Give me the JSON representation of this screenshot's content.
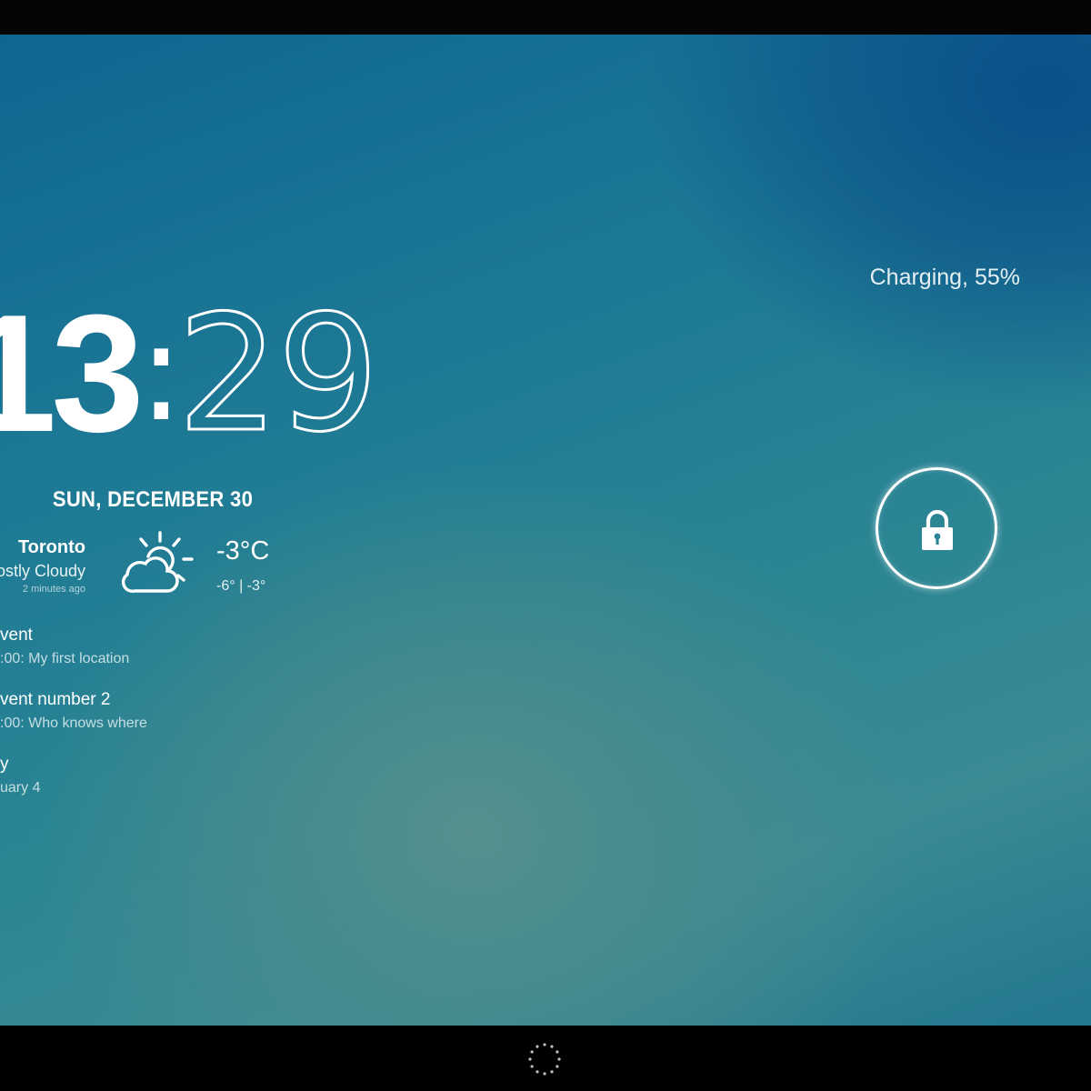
{
  "clock": {
    "hours": "13",
    "separator": ":",
    "minutes": "29"
  },
  "date": "SUN, DECEMBER 30",
  "weather": {
    "city": "Toronto",
    "condition": "ostly Cloudy",
    "updated": "2 minutes ago",
    "icon": "partly-cloudy-icon",
    "temperature": "-3°C",
    "range": "-6° | -3°"
  },
  "events": [
    {
      "title": "vent",
      "detail": ":00: My first location"
    },
    {
      "title": "vent number 2",
      "detail": ":00: Who knows where"
    },
    {
      "title": "y",
      "detail": "uary 4"
    }
  ],
  "battery": {
    "status_text": "Charging, 55%"
  },
  "lock": {
    "icon": "padlock-icon"
  },
  "colors": {
    "accent_text": "#ffffff",
    "status_bar": "#050505",
    "nav_bar": "#000000"
  }
}
